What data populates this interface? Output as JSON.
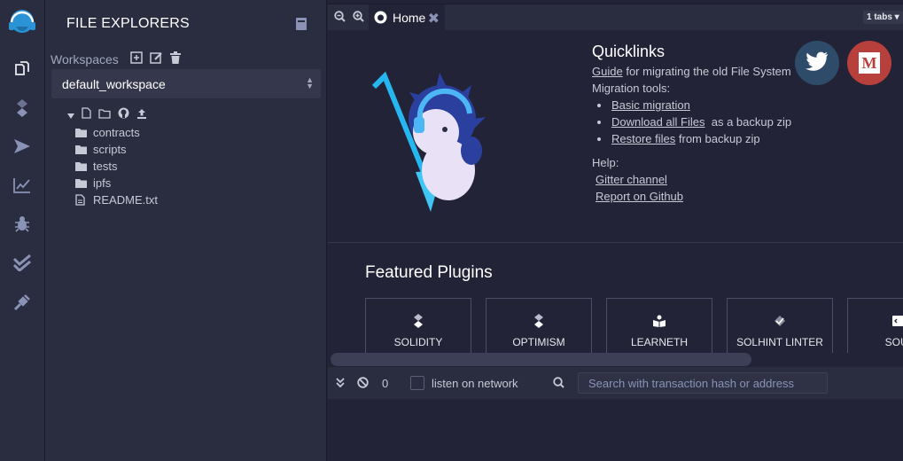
{
  "sidebar": {
    "logo": "remix-logo-icon",
    "icons": [
      "file-explorer-icon",
      "solidity-compiler-icon",
      "deploy-run-icon",
      "analysis-icon",
      "debugger-icon",
      "unit-testing-icon",
      "plugin-manager-icon"
    ]
  },
  "file_explorer": {
    "title": "FILE EXPLORERS",
    "workspaces_label": "Workspaces",
    "workspace_selected": "default_workspace",
    "tree": [
      {
        "name": "contracts",
        "type": "folder"
      },
      {
        "name": "scripts",
        "type": "folder"
      },
      {
        "name": "tests",
        "type": "folder"
      },
      {
        "name": "ipfs",
        "type": "folder"
      },
      {
        "name": "README.txt",
        "type": "file"
      }
    ]
  },
  "tabs": {
    "home_label": "Home",
    "count_label": "1 tabs"
  },
  "home": {
    "quicklinks_title": "Quicklinks",
    "guide_link": "Guide",
    "guide_text": "for migrating the old File System",
    "migration_tools_label": "Migration tools:",
    "basic_migration": "Basic migration",
    "download_all_files": "Download all Files",
    "download_suffix": "as a backup zip",
    "restore_files": "Restore files",
    "restore_suffix": "from backup zip",
    "help_label": "Help:",
    "gitter_channel": "Gitter channel",
    "report_github": "Report on Github",
    "featured_plugins_title": "Featured Plugins",
    "plugins": [
      "SOLIDITY",
      "OPTIMISM",
      "LEARNETH",
      "SOLHINT LINTER",
      "SOUR"
    ],
    "medium_letter": "M"
  },
  "terminal": {
    "count": "0",
    "listen_label": "listen on network",
    "search_placeholder": "Search with transaction hash or address"
  },
  "colors": {
    "background": "#222336",
    "panel": "#2a2c3f",
    "twitter": "#2e4b6a",
    "medium": "#b8403c",
    "accent": "#2a93d5"
  }
}
